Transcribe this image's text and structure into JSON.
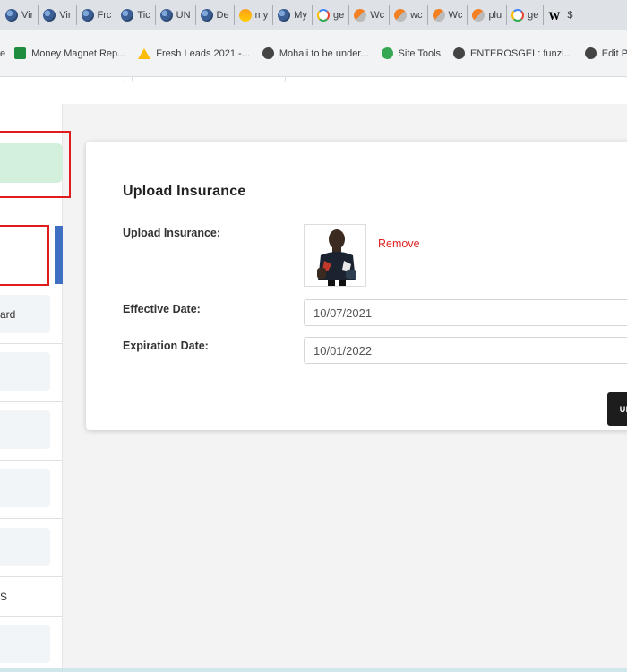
{
  "browser": {
    "tabs": [
      {
        "icon": "globe-icon",
        "label": "Vir"
      },
      {
        "icon": "globe-icon",
        "label": "Vir"
      },
      {
        "icon": "globe-icon",
        "label": "Frc"
      },
      {
        "icon": "globe-icon",
        "label": "Tic"
      },
      {
        "icon": "globe-icon",
        "label": "UN"
      },
      {
        "icon": "globe-icon",
        "label": "De"
      },
      {
        "icon": "pm-icon",
        "label": "my"
      },
      {
        "icon": "globe-icon",
        "label": "My"
      },
      {
        "icon": "google-icon",
        "label": "ge"
      },
      {
        "icon": "stackoverflow-icon",
        "label": "Wc"
      },
      {
        "icon": "stackoverflow-icon",
        "label": "wc"
      },
      {
        "icon": "stackoverflow-icon",
        "label": "Wc"
      },
      {
        "icon": "stackoverflow-icon",
        "label": "plu"
      },
      {
        "icon": "google-icon",
        "label": "ge"
      },
      {
        "icon": "wikipedia-icon",
        "label": "W",
        "extra": "$"
      }
    ],
    "bookmarks": [
      {
        "label": "e"
      },
      {
        "label": "Money Magnet Rep..."
      },
      {
        "label": "Fresh Leads 2021 -..."
      },
      {
        "label": "Mohali to be under..."
      },
      {
        "label": "Site Tools"
      },
      {
        "label": "ENTEROSGEL: funzi..."
      },
      {
        "label": "Edit Post ‹ C"
      }
    ]
  },
  "sidebar": {
    "items": [
      {
        "label": "ard"
      },
      {
        "label": ""
      },
      {
        "label": ""
      },
      {
        "label": ""
      },
      {
        "label": ""
      },
      {
        "label": "S"
      },
      {
        "label": ""
      }
    ]
  },
  "form": {
    "title": "Upload Insurance",
    "upload_label": "Upload Insurance:",
    "remove_label": "Remove",
    "effective_label": "Effective Date:",
    "effective_value": "10/07/2021",
    "expiration_label": "Expiration Date:",
    "expiration_value": "10/01/2022",
    "upload_button": "UPLO"
  },
  "colors": {
    "accent_blue": "#3e6fc2",
    "highlight_green": "#d3f0dc",
    "remove_red": "#e02424",
    "annotation_red": "#e01b1b"
  }
}
